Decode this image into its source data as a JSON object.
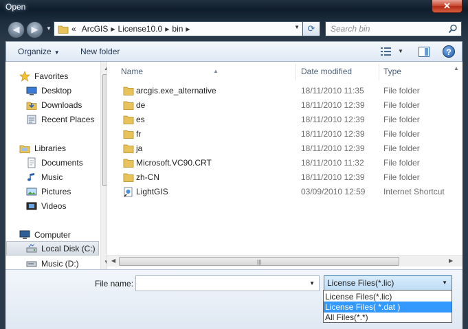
{
  "window": {
    "title": "Open",
    "close_label": "x"
  },
  "address": {
    "overflow": "«",
    "breadcrumbs": [
      "ArcGIS",
      "License10.0",
      "bin"
    ],
    "search_placeholder": "Search bin"
  },
  "toolbar": {
    "organize_label": "Organize",
    "new_folder_label": "New folder"
  },
  "nav": {
    "favorites": "Favorites",
    "desktop": "Desktop",
    "downloads": "Downloads",
    "recent_places": "Recent Places",
    "libraries": "Libraries",
    "documents": "Documents",
    "music": "Music",
    "pictures": "Pictures",
    "videos": "Videos",
    "computer": "Computer",
    "local_disk": "Local Disk (C:)",
    "music_drive": "Music (D:)"
  },
  "columns": {
    "name": "Name",
    "date": "Date modified",
    "type": "Type"
  },
  "files": [
    {
      "name": "arcgis.exe_alternative",
      "date": "18/11/2010 11:35",
      "type": "File folder",
      "icon": "folder-icon"
    },
    {
      "name": "de",
      "date": "18/11/2010 12:39",
      "type": "File folder",
      "icon": "folder-icon"
    },
    {
      "name": "es",
      "date": "18/11/2010 12:39",
      "type": "File folder",
      "icon": "folder-icon"
    },
    {
      "name": "fr",
      "date": "18/11/2010 12:39",
      "type": "File folder",
      "icon": "folder-icon"
    },
    {
      "name": "ja",
      "date": "18/11/2010 12:39",
      "type": "File folder",
      "icon": "folder-icon"
    },
    {
      "name": "Microsoft.VC90.CRT",
      "date": "18/11/2010 11:32",
      "type": "File folder",
      "icon": "folder-icon"
    },
    {
      "name": "zh-CN",
      "date": "18/11/2010 12:39",
      "type": "File folder",
      "icon": "folder-icon"
    },
    {
      "name": "LightGIS",
      "date": "03/09/2010 12:59",
      "type": "Internet Shortcut",
      "icon": "shortcut-icon"
    }
  ],
  "bottom": {
    "filename_label": "File name:",
    "filename_value": "",
    "file_type_selected": "License Files(*.lic)",
    "file_type_options": [
      "License Files(*.lic)",
      "License Files( *.dat )",
      "All Files(*.*)"
    ]
  },
  "colors": {
    "highlight": "#3399ff",
    "folder": "#e8c25a",
    "link": "#1e3250"
  }
}
